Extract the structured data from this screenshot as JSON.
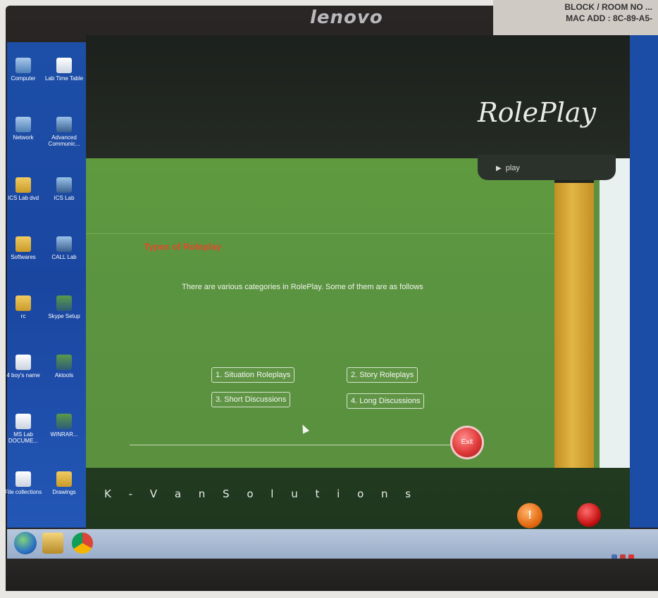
{
  "monitor": {
    "brand": "lenovo",
    "sticker_lines": [
      "BLOCK / ROOM NO ...",
      "MAC ADD : 8C-89-A5-"
    ]
  },
  "desktop": {
    "icons": [
      {
        "label": "Computer",
        "icon": "computer-icon"
      },
      {
        "label": "Lab Time Table",
        "icon": "document-icon"
      },
      {
        "label": "Network",
        "icon": "network-icon"
      },
      {
        "label": "Advanced Communic...",
        "icon": "shortcut-icon"
      },
      {
        "label": "ICS Lab dvd",
        "icon": "folder-icon"
      },
      {
        "label": "ICS Lab",
        "icon": "shortcut-icon"
      },
      {
        "label": "Softwares",
        "icon": "folder-icon"
      },
      {
        "label": "CALL Lab",
        "icon": "shortcut-icon"
      },
      {
        "label": "rc",
        "icon": "folder-icon"
      },
      {
        "label": "Skype Setup",
        "icon": "app-icon"
      },
      {
        "label": "4 boy's name",
        "icon": "document-icon"
      },
      {
        "label": "Aktools",
        "icon": "app-icon"
      },
      {
        "label": "MS Lab DOCUME...",
        "icon": "document-icon"
      },
      {
        "label": "WINRAR...",
        "icon": "app-icon"
      },
      {
        "label": "File collections",
        "icon": "document-icon"
      },
      {
        "label": "Drawings",
        "icon": "folder-icon"
      }
    ]
  },
  "app": {
    "title": "RolePlay",
    "play_label": "play",
    "section_title": "Types of Roleplay",
    "intro": "There are various  categories in RolePlay. Some of them are as follows",
    "categories": [
      {
        "label": "1. Situation Roleplays"
      },
      {
        "label": "2. Story Roleplays"
      },
      {
        "label": "3. Short Discussions"
      },
      {
        "label": "4. Long Discussions"
      }
    ],
    "exit_label": "Exit",
    "company": "K - V a n S o l u t i o n s",
    "footer_icons": [
      "contact-icon",
      "shutdown-icon"
    ]
  },
  "taskbar": {
    "items": [
      "start-orb-icon",
      "explorer-icon",
      "chrome-icon"
    ]
  },
  "colors": {
    "stage_green": "#5b9440",
    "accent_orange": "#e2492c",
    "gold": "#e1b644",
    "exit_red": "#e03a3a"
  }
}
